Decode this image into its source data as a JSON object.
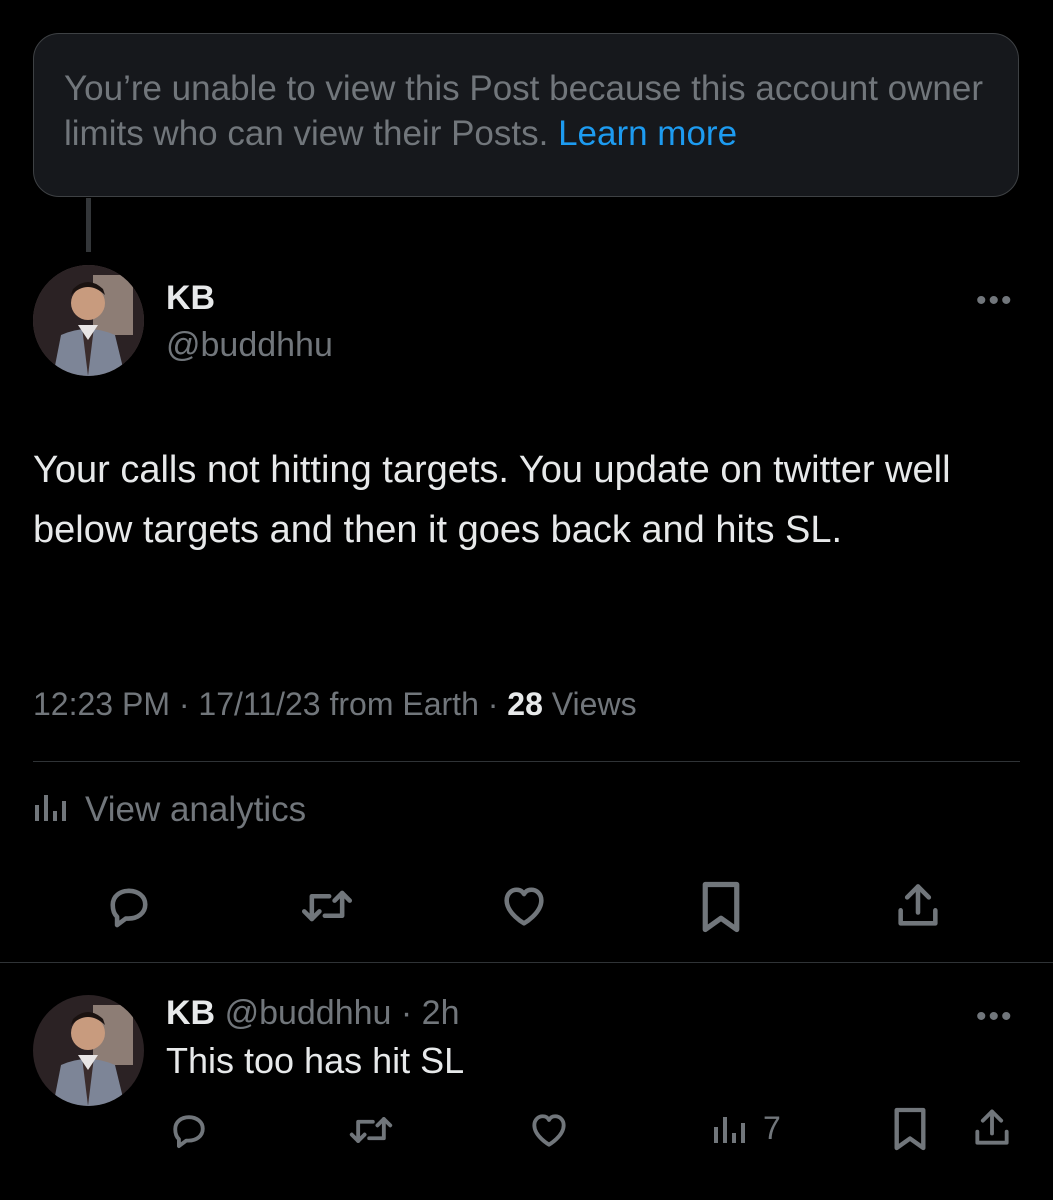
{
  "notice": {
    "text": "You’re unable to view this Post because this account owner limits who can view their Posts.",
    "link_label": "Learn more"
  },
  "post": {
    "name": "KB",
    "handle": "@buddhhu",
    "body": "Your calls not hitting targets. You update on twitter well below targets and then it goes back and hits SL.",
    "time": "12:23 PM",
    "date_source": "17/11/23 from Earth",
    "views_count": "28",
    "views_label": "Views",
    "more_label": "•••",
    "analytics_label": "View analytics"
  },
  "reply": {
    "name": "KB",
    "handle": "@buddhhu",
    "age": "2h",
    "body": "This too has hit SL",
    "views": "7",
    "more_label": "•••"
  },
  "icons": {
    "reply": "reply-icon",
    "retweet": "retweet-icon",
    "like": "heart-icon",
    "bookmark": "bookmark-icon",
    "share": "share-icon",
    "analytics": "bar-chart-icon"
  },
  "colors": {
    "background": "#000000",
    "text": "#e7e9ea",
    "muted": "#71767b",
    "link": "#1d9bf0"
  }
}
